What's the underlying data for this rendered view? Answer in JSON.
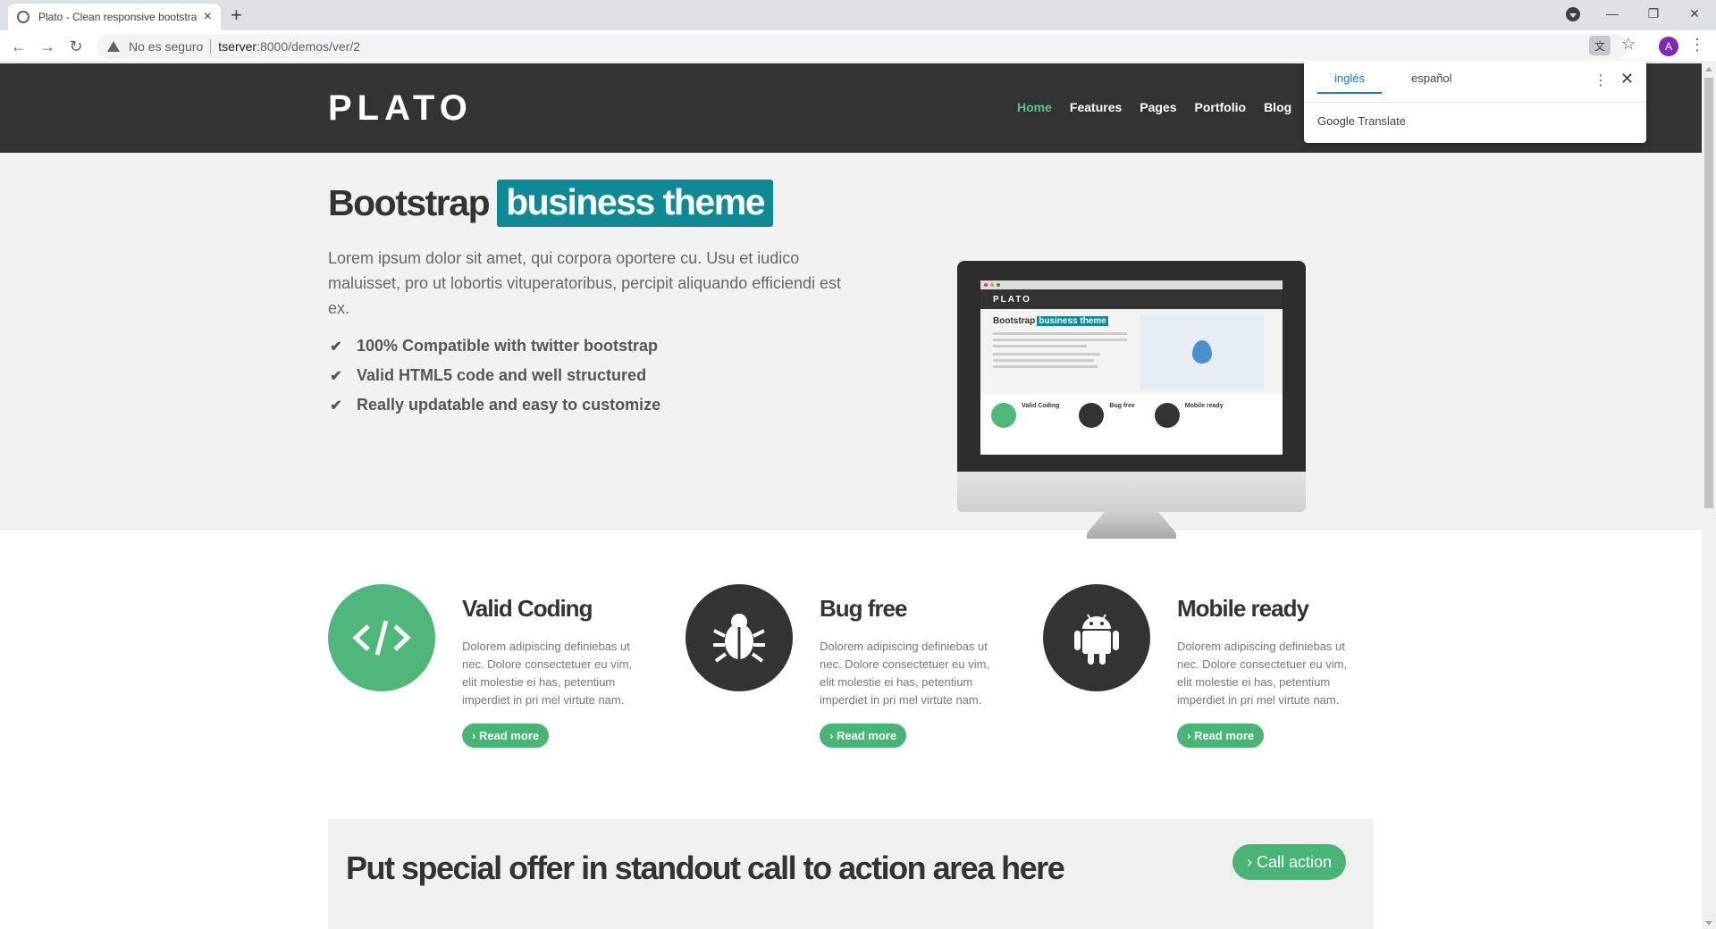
{
  "browser": {
    "tab_title": "Plato - Clean responsive bootstra",
    "tab_close": "×",
    "new_tab": "+",
    "security_label": "No es seguro",
    "url_host": "tserver",
    "url_path": ":8000/demos/ver/2",
    "avatar_letter": "A",
    "window_controls": {
      "minimize": "—",
      "restore": "❐",
      "close": "✕"
    }
  },
  "header": {
    "logo": "PLATO",
    "nav": [
      "Home",
      "Features",
      "Pages",
      "Portfolio",
      "Blog"
    ],
    "active_index": 0,
    "accent_color": "#5ec38b"
  },
  "hero": {
    "title_plain": "Bootstrap",
    "title_highlight": "business theme",
    "lead": "Lorem ipsum dolor sit amet, qui corpora oportere cu. Usu et iudico maluisset, pro ut lobortis vituperatoribus, percipit aliquando efficiendi est ex.",
    "list": [
      "100% Compatible with twitter bootstrap",
      "Valid HTML5 code and well structured",
      "Really updatable and easy to customize"
    ],
    "highlight_color": "#0f8a94"
  },
  "monitor_preview": {
    "logo": "PLATO",
    "title_plain": "Bootstrap",
    "title_highlight": "business theme",
    "features": [
      "Valid Coding",
      "Bug free",
      "Mobile ready"
    ]
  },
  "features": [
    {
      "title": "Valid Coding",
      "icon": "code-icon",
      "text": "Dolorem adipiscing definiebas ut nec. Dolore consectetuer eu vim, elit molestie ei has, petentium imperdiet in pri mel virtute nam.",
      "button": "› Read more",
      "circle_color": "#4fb779"
    },
    {
      "title": "Bug free",
      "icon": "bug-icon",
      "text": "Dolorem adipiscing definiebas ut nec. Dolore consectetuer eu vim, elit molestie ei has, petentium imperdiet in pri mel virtute nam.",
      "button": "› Read more",
      "circle_color": "#333333"
    },
    {
      "title": "Mobile ready",
      "icon": "android-icon",
      "text": "Dolorem adipiscing definiebas ut nec. Dolore consectetuer eu vim, elit molestie ei has, petentium imperdiet in pri mel virtute nam.",
      "button": "› Read more",
      "circle_color": "#333333"
    }
  ],
  "cta": {
    "text": "Put special offer in standout call to action area here",
    "button": "› Call action"
  },
  "translate_popup": {
    "tab_source": "inglés",
    "tab_target": "español",
    "brand_google": "Google",
    "brand_translate": "Translate"
  }
}
